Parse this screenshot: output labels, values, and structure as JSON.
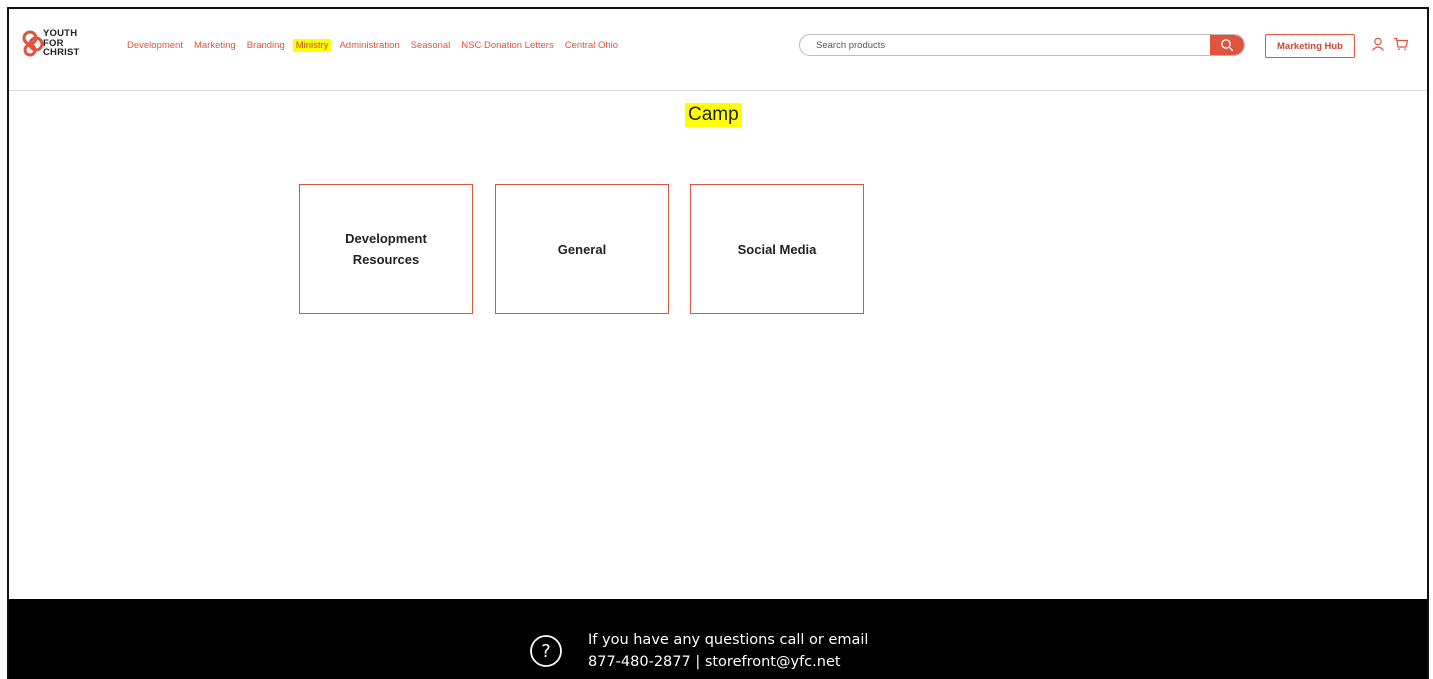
{
  "brand": {
    "logo_line1": "YOUTH",
    "logo_line2": "FOR",
    "logo_line3": "CHRIST",
    "accent": "#e0533c"
  },
  "nav": {
    "items": [
      {
        "label": "Development"
      },
      {
        "label": "Marketing"
      },
      {
        "label": "Branding"
      },
      {
        "label": "Ministry",
        "highlighted": true
      },
      {
        "label": "Administration"
      },
      {
        "label": "Seasonal"
      },
      {
        "label": "NSC Donation Letters"
      },
      {
        "label": "Central Ohio"
      }
    ]
  },
  "search": {
    "placeholder": "Search products",
    "value": ""
  },
  "header": {
    "marketing_hub_label": "Marketing Hub",
    "user_icon": "user-icon",
    "cart_icon": "cart-icon"
  },
  "main": {
    "title": "Camp",
    "cards": [
      {
        "label": "Development Resources"
      },
      {
        "label": "General"
      },
      {
        "label": "Social Media"
      }
    ]
  },
  "footer": {
    "line1": "If you have any questions call or email",
    "line2": "877-480-2877 | storefront@yfc.net",
    "icon": "help-icon"
  }
}
